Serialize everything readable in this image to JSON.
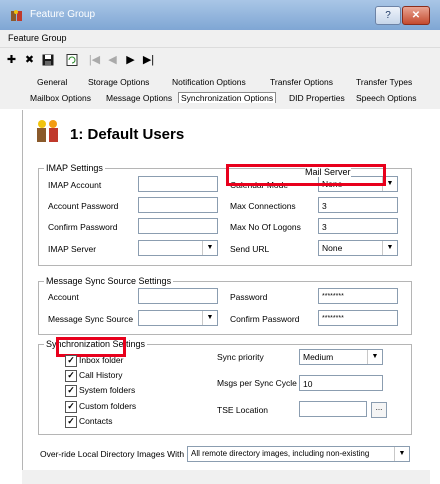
{
  "window": {
    "title": "Feature Group",
    "help_btn": "?",
    "close_btn": "✕"
  },
  "menu": {
    "label": "Feature Group"
  },
  "toolbar": {
    "icons": [
      "add-icon",
      "delete-icon",
      "save-icon",
      "refresh-icon",
      "first-icon",
      "prev-icon",
      "next-icon",
      "last-icon"
    ]
  },
  "tabs": {
    "row1": [
      "General",
      "Storage Options",
      "Notification Options",
      "Transfer Options",
      "Transfer Types"
    ],
    "row2": [
      "Mailbox Options",
      "Message Options",
      "Synchronization Options",
      "DID Properties",
      "Speech Options"
    ],
    "active": "Synchronization Options"
  },
  "header": {
    "title": "1: Default Users"
  },
  "imap": {
    "group_label": "IMAP Settings",
    "account_label": "IMAP Account",
    "account_password_label": "Account Password",
    "confirm_password_label": "Confirm Password",
    "server_label": "IMAP Server",
    "overlay_label": "Mail Server",
    "calendar_mode_label": "Calendar Mode",
    "calendar_mode_value": "None",
    "max_connections_label": "Max Connections",
    "max_connections_value": "3",
    "max_logons_label": "Max No Of Logons",
    "max_logons_value": "3",
    "send_url_label": "Send URL",
    "send_url_value": "None"
  },
  "msgsync": {
    "group_label": "Message Sync Source Settings",
    "account_label": "Account",
    "source_label": "Message Sync Source",
    "password_label": "Password",
    "password_value": "********",
    "confirm_label": "Confirm Password",
    "confirm_value": "********"
  },
  "sync": {
    "group_label": "Synchronization Settings",
    "items": [
      "Inbox folder",
      "Call History",
      "System folders",
      "Custom folders",
      "Contacts"
    ],
    "priority_label": "Sync priority",
    "priority_value": "Medium",
    "msgs_per_cycle_label": "Msgs per Sync Cycle",
    "msgs_per_cycle_value": "10",
    "tse_label": "TSE Location",
    "browse_label": "..."
  },
  "override": {
    "label": "Over-ride Local Directory Images With",
    "value": "All remote directory images, including non-existing"
  },
  "colors": {
    "highlight": "#e8001c",
    "titlebar": "#7fa6d4"
  }
}
